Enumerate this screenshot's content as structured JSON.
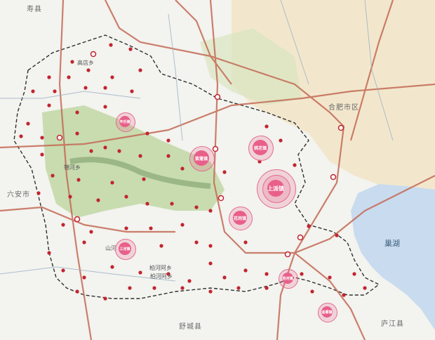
{
  "map": {
    "region_labels": {
      "west": "六安市",
      "north": "寿县",
      "south": "舒城县",
      "southeast": "庐江县",
      "city": "合肥市区",
      "lake": "巢湖"
    },
    "major_towns": [
      {
        "name": "上派镇",
        "tier": "primary"
      },
      {
        "name": "桃花镇",
        "tier": "secondary"
      },
      {
        "name": "紫蓬镇",
        "tier": "secondary"
      },
      {
        "name": "花岗镇",
        "tier": "secondary"
      },
      {
        "name": "三河镇",
        "tier": "secondary"
      },
      {
        "name": "丰乐镇",
        "tier": "secondary"
      },
      {
        "name": "杨河镇",
        "tier": "secondary"
      },
      {
        "name": "金寨镇",
        "tier": "secondary"
      }
    ],
    "place_labels": {
      "gaodian": "高店乡",
      "jinhe": "锦河乡",
      "shanhe": "山河",
      "baihe": "柏河阿乡",
      "baiheduan": "柏河阿乡"
    },
    "colors": {
      "town_marker": "#c2242f",
      "hub_fill": "#e8608a",
      "road": "#c46a55",
      "lake": "#c9dbee",
      "boundary": "#2f2f2f"
    }
  }
}
